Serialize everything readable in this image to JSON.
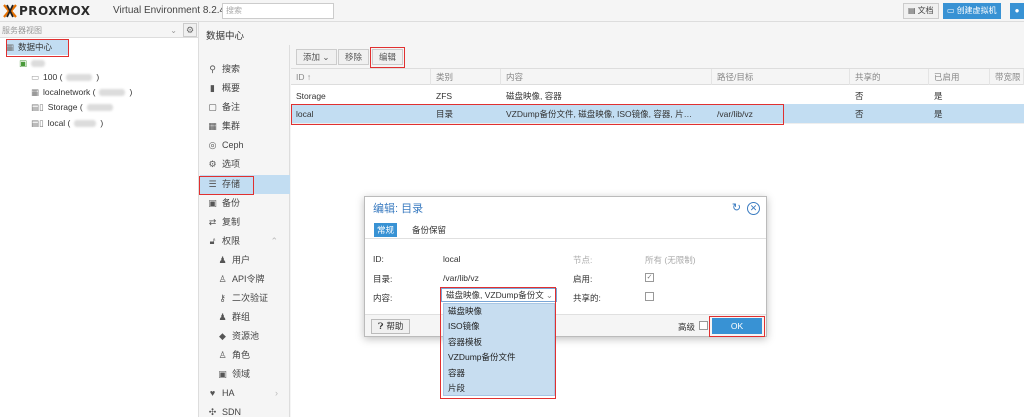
{
  "topbar": {
    "logo_text": "PROXMOX",
    "product": "Virtual Environment 8.2.4",
    "search_placeholder": "搜索",
    "docs_label": "文档",
    "create_vm_label": "创建虚拟机",
    "colors": {
      "accent": "#3892d4",
      "logo_orange": "#e57000"
    }
  },
  "tree": {
    "view_select": "服务器视图",
    "items": [
      {
        "label": "数据中心",
        "icon": "datacenter-icon"
      },
      {
        "label": "",
        "icon": "node-icon"
      },
      {
        "label": "100 (",
        "icon": "vm-icon"
      },
      {
        "label": "localnetwork (",
        "icon": "network-icon"
      },
      {
        "label": "Storage (",
        "icon": "storage-icon"
      },
      {
        "label": "local (",
        "icon": "storage-icon"
      }
    ]
  },
  "main": {
    "title": "数据中心",
    "nav": [
      {
        "label": "搜索",
        "icon": "search-icon"
      },
      {
        "label": "概要",
        "icon": "book-icon"
      },
      {
        "label": "备注",
        "icon": "notes-icon"
      },
      {
        "label": "集群",
        "icon": "cluster-icon"
      },
      {
        "label": "Ceph",
        "icon": "ceph-icon"
      },
      {
        "label": "选项",
        "icon": "gear-icon"
      },
      {
        "label": "存储",
        "icon": "database-icon"
      },
      {
        "label": "备份",
        "icon": "floppy-icon"
      },
      {
        "label": "复制",
        "icon": "retweet-icon"
      },
      {
        "label": "权限",
        "icon": "unlock-icon"
      },
      {
        "label": "用户",
        "icon": "user-icon"
      },
      {
        "label": "API令牌",
        "icon": "user-outline-icon"
      },
      {
        "label": "二次验证",
        "icon": "key-icon"
      },
      {
        "label": "群组",
        "icon": "users-icon"
      },
      {
        "label": "资源池",
        "icon": "tags-icon"
      },
      {
        "label": "角色",
        "icon": "male-icon"
      },
      {
        "label": "领域",
        "icon": "address-book-icon"
      },
      {
        "label": "HA",
        "icon": "heartbeat-icon"
      },
      {
        "label": "SDN",
        "icon": "sdn-icon"
      }
    ],
    "toolbar": {
      "add": "添加",
      "remove": "移除",
      "edit": "编辑"
    },
    "table": {
      "headers": [
        "ID ↑",
        "类别",
        "内容",
        "路径/目标",
        "共享的",
        "已启用",
        "带宽限"
      ],
      "rows": [
        [
          "Storage",
          "ZFS",
          "磁盘映像, 容器",
          "",
          "否",
          "是"
        ],
        [
          "local",
          "目录",
          "VZDump备份文件, 磁盘映像, ISO镜像, 容器, 片…",
          "/var/lib/vz",
          "否",
          "是"
        ]
      ]
    }
  },
  "dialog": {
    "title": "编辑: 目录",
    "tabs": [
      "常规",
      "备份保留"
    ],
    "id_label": "ID:",
    "id_value": "local",
    "dir_label": "目录:",
    "dir_value": "/var/lib/vz",
    "content_label": "内容:",
    "content_value": "磁盘映像, VZDump备份文件",
    "nodes_label": "节点:",
    "nodes_value": "所有 (无限制)",
    "enable_label": "启用:",
    "enable_checked": true,
    "shared_label": "共享的:",
    "shared_checked": false,
    "help_label": "帮助",
    "advanced_label": "高级",
    "ok_label": "OK",
    "dropdown_options": [
      "磁盘映像",
      "ISO镜像",
      "容器模板",
      "VZDump备份文件",
      "容器",
      "片段"
    ]
  }
}
